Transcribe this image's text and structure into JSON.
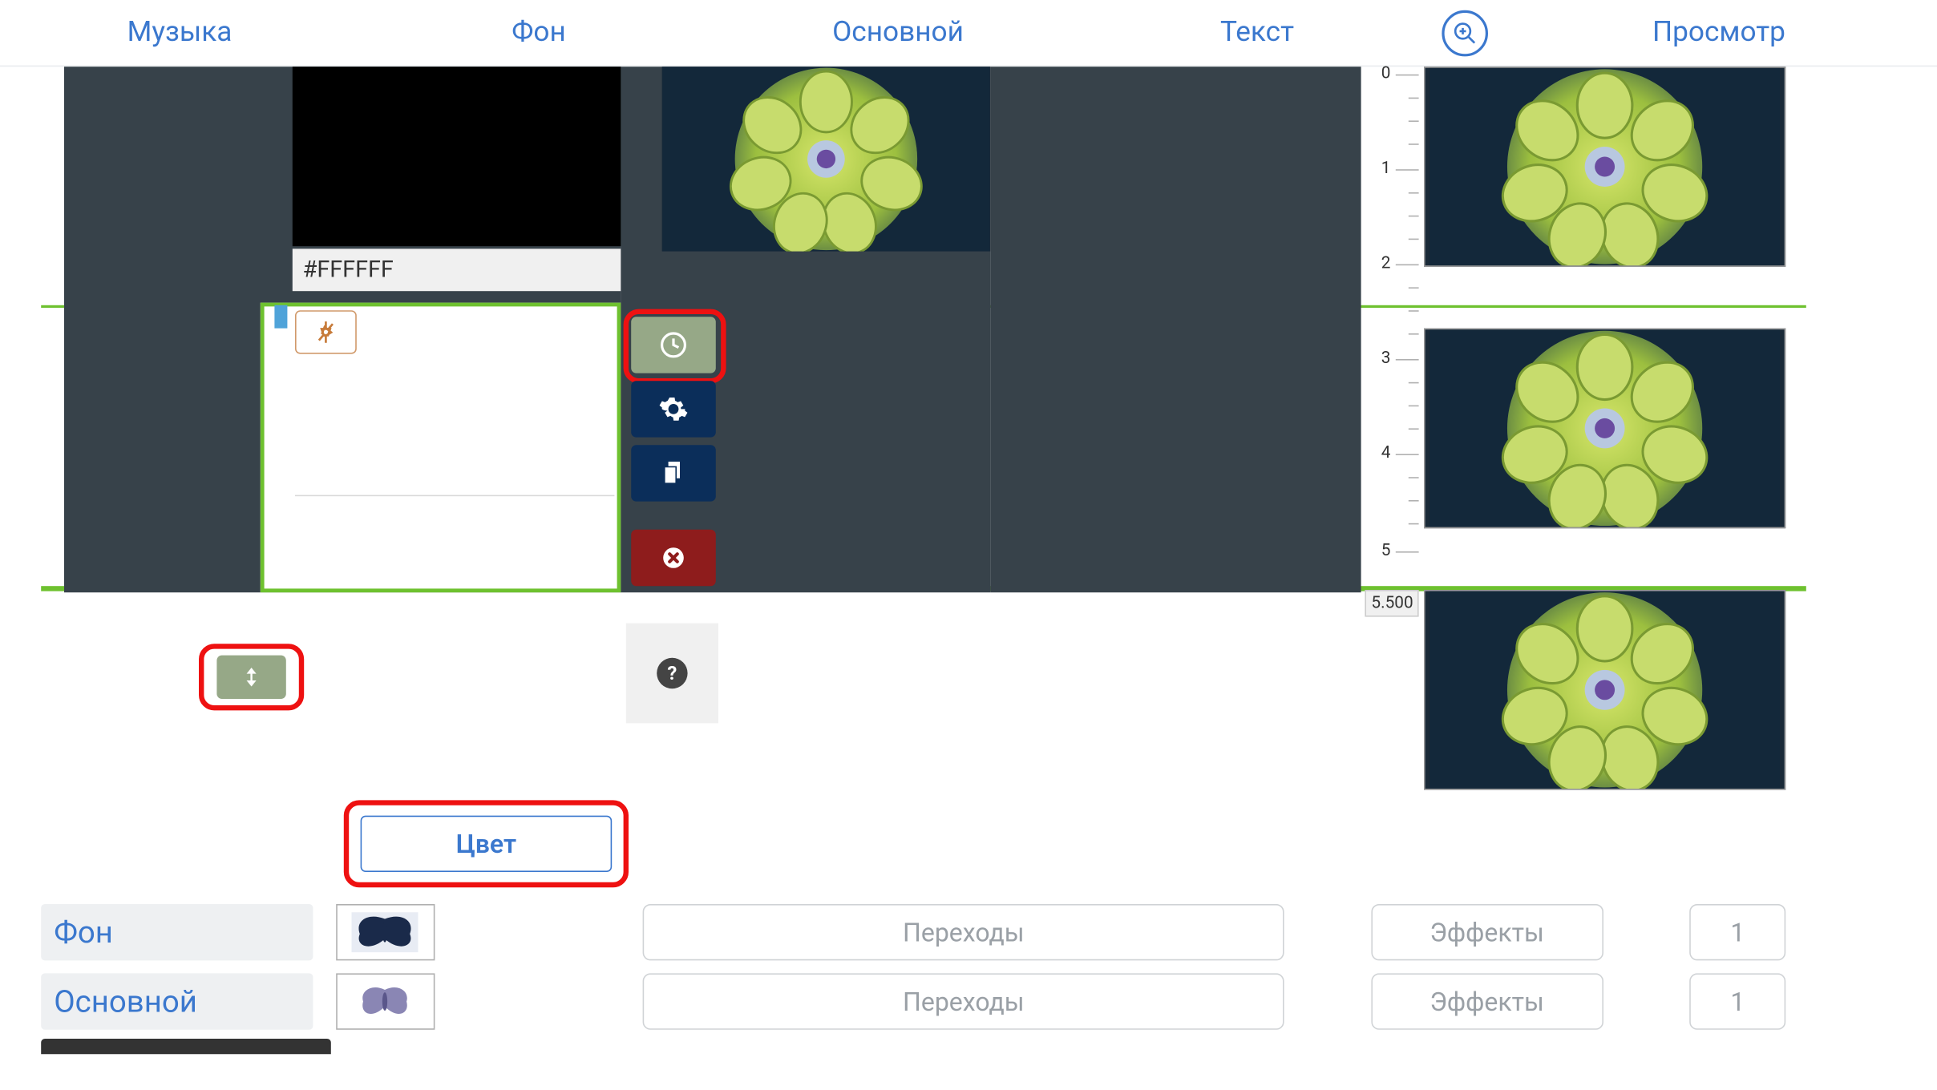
{
  "tabs": {
    "music": "Музыка",
    "background": "Фон",
    "main": "Основной",
    "text": "Текст",
    "preview": "Просмотр"
  },
  "bg": {
    "hex": "#FFFFFF"
  },
  "ruler": {
    "ticks": [
      "0",
      "1",
      "2",
      "3",
      "4",
      "5"
    ],
    "end": "5.500"
  },
  "color_button": "Цвет",
  "layers": [
    {
      "name": "Фон",
      "transitions": "Переходы",
      "effects": "Эффекты",
      "count": "1",
      "butterfly_variant": "sharp"
    },
    {
      "name": "Основной",
      "transitions": "Переходы",
      "effects": "Эффекты",
      "count": "1",
      "butterfly_variant": "soft"
    }
  ],
  "icons": {
    "zoom": "zoom-in-icon",
    "pin": "pin-icon",
    "height": "vertical-resize-icon",
    "clock": "clock-icon",
    "gear": "gear-icon",
    "copy": "copy-icon",
    "delete": "delete-icon",
    "help": "?"
  },
  "colors": {
    "accent": "#3b78ce",
    "highlight": "#e11",
    "track": "#37424a",
    "olive": "#96a887",
    "danger": "#8e1c1c",
    "select": "#6ec12f"
  }
}
